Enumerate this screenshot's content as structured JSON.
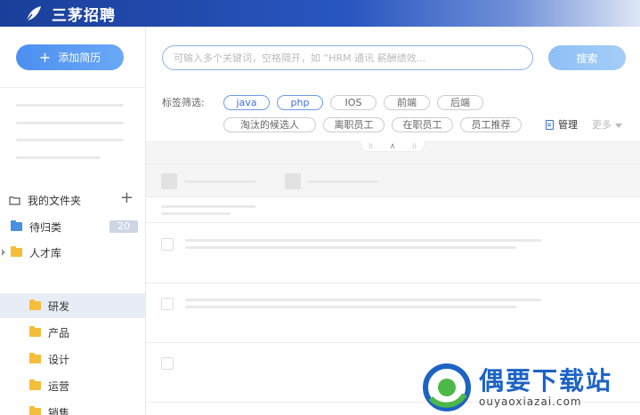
{
  "header": {
    "brand": "三茅招聘"
  },
  "sidebar": {
    "add_button": "添加简历",
    "folder_title": "我的文件夹",
    "items": [
      {
        "label": "待归类",
        "badge": "20"
      },
      {
        "label": "人才库"
      },
      {
        "label": "研发"
      },
      {
        "label": "产品"
      },
      {
        "label": "设计"
      },
      {
        "label": "运营"
      },
      {
        "label": "销售"
      }
    ]
  },
  "search": {
    "placeholder": "可输入多个关键词，空格隔开，如 “HRM 通讯 薪酬绩效...",
    "button": "搜索"
  },
  "filters": {
    "label": "标签筛选:",
    "tags": [
      "java",
      "php",
      "IOS",
      "前端",
      "后端",
      "淘汰的候选人",
      "离职员工",
      "在职员工",
      "员工推荐"
    ],
    "manage": "管理",
    "more": "更多"
  },
  "watermark": {
    "title": "偶要下载站",
    "url": "ouyaoxiazai.com"
  },
  "colors": {
    "header": "#1a3f9a",
    "accent": "#4c8ff0",
    "folder": "#f5bd3a"
  }
}
